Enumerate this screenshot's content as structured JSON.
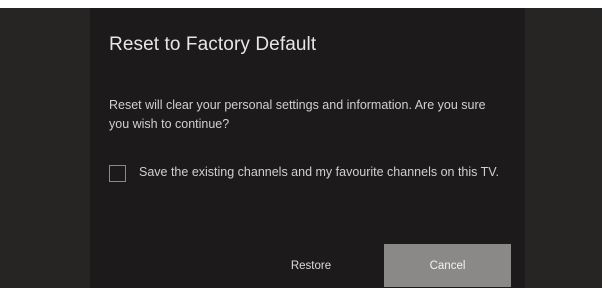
{
  "dialog": {
    "title": "Reset to Factory Default",
    "message": "Reset will clear your personal settings and information. Are you sure you wish to continue?",
    "checkbox": {
      "label": "Save the existing channels and my favourite channels on this TV.",
      "checked": false
    },
    "buttons": {
      "restore_label": "Restore",
      "cancel_label": "Cancel"
    },
    "focused_button": "cancel"
  },
  "colors": {
    "background": "#272424",
    "dialog_background": "#1c1a1a",
    "focused_button": "#8b8988",
    "text": "#d0d0d0"
  }
}
